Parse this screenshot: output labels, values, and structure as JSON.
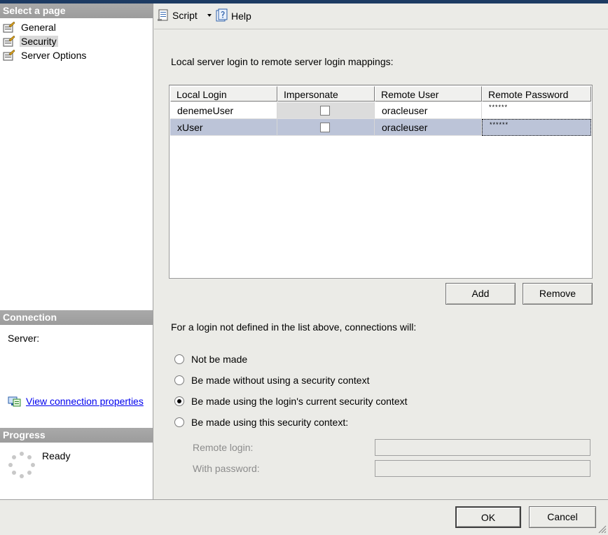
{
  "left_pane": {
    "select_page_header": "Select a page",
    "pages": [
      {
        "label": "General",
        "icon": "page-icon"
      },
      {
        "label": "Security",
        "icon": "page-icon",
        "selected": true
      },
      {
        "label": "Server Options",
        "icon": "page-icon"
      }
    ],
    "connection_header": "Connection",
    "server_label": "Server:",
    "view_connection_link": "View connection properties",
    "progress_header": "Progress",
    "progress_status": "Ready"
  },
  "toolbar": {
    "script_label": "Script",
    "help_label": "Help"
  },
  "security": {
    "mappings_label": "Local server login to remote server login mappings:",
    "columns": [
      "Local Login",
      "Impersonate",
      "Remote User",
      "Remote Password"
    ],
    "rows": [
      {
        "local_login": "denemeUser",
        "impersonate": false,
        "remote_user": "oracleuser",
        "remote_password": "******"
      },
      {
        "local_login": "xUser",
        "impersonate": false,
        "remote_user": "oracleuser",
        "remote_password": "******",
        "selected": true
      }
    ],
    "add_button": "Add",
    "remove_button": "Remove",
    "undefined_login_label": "For a login not defined in the list above, connections will:",
    "options": [
      {
        "label": "Not be made",
        "selected": false
      },
      {
        "label": "Be made without using a security context",
        "selected": false
      },
      {
        "label": "Be made using the login's current security context",
        "selected": true
      },
      {
        "label": "Be made using this security context:",
        "selected": false
      }
    ],
    "remote_login_label": "Remote login:",
    "with_password_label": "With password:"
  },
  "dialog_buttons": {
    "ok": "OK",
    "cancel": "Cancel"
  },
  "colors": {
    "section_header": "#a9a9a9",
    "selected_row": "#bcc4d8",
    "link": "#0000ee"
  }
}
